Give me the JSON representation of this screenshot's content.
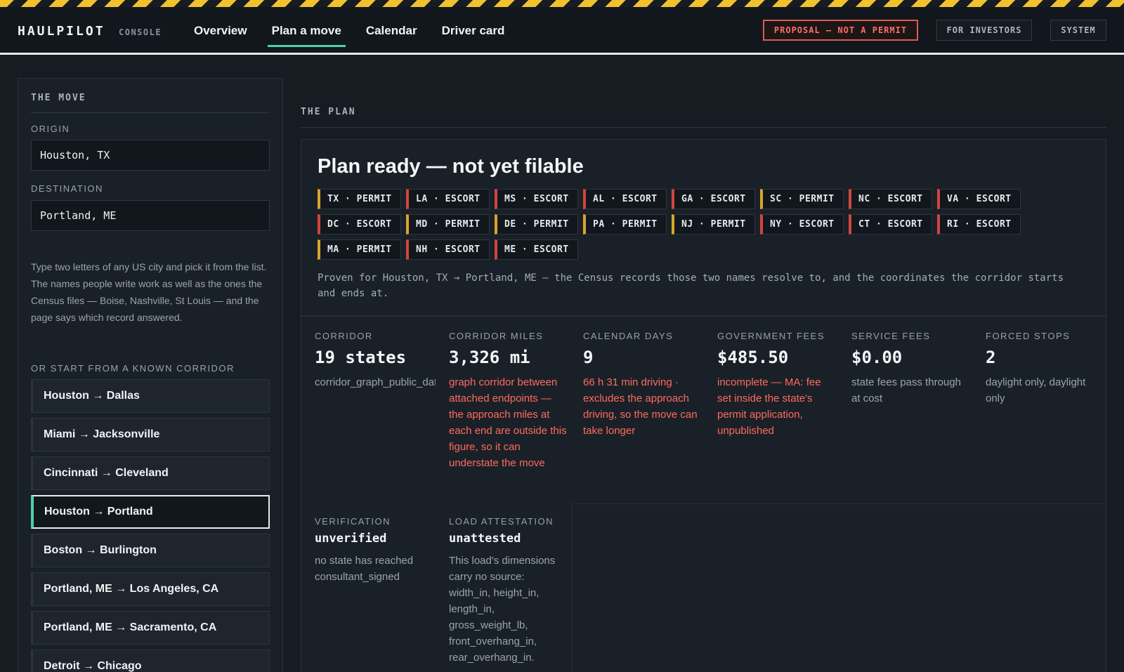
{
  "brand": {
    "name": "HAULPILOT",
    "sub": "CONSOLE"
  },
  "nav": {
    "items": [
      "Overview",
      "Plan a move",
      "Calendar",
      "Driver card"
    ],
    "active": "Plan a move"
  },
  "header_buttons": {
    "proposal": "PROPOSAL — NOT A PERMIT",
    "investors": "FOR INVESTORS",
    "system": "SYSTEM"
  },
  "move": {
    "title": "THE MOVE",
    "origin_label": "ORIGIN",
    "origin_value": "Houston, TX",
    "destination_label": "DESTINATION",
    "destination_value": "Portland, ME",
    "help": "Type two letters of any US city and pick it from the list. The names people write work as well as the ones the Census files — Boise, Nashville, St Louis — and the page says which record answered.",
    "corridor_label": "OR START FROM A KNOWN CORRIDOR",
    "corridors": [
      "Houston → Dallas",
      "Miami → Jacksonville",
      "Cincinnati → Cleveland",
      "Houston → Portland",
      "Boston → Burlington",
      "Portland, ME → Los Angeles, CA",
      "Portland, ME → Sacramento, CA",
      "Detroit → Chicago"
    ],
    "active_corridor": "Houston → Portland"
  },
  "plan": {
    "title": "THE PLAN",
    "headline": "Plan ready — not yet filable",
    "chips": [
      [
        "TX · PERMIT",
        "LA · ESCORT",
        "MS · ESCORT",
        "AL · ESCORT",
        "GA · ESCORT",
        "SC · PERMIT",
        "NC · ESCORT",
        "VA · ESCORT"
      ],
      [
        "DC · ESCORT",
        "MD · PERMIT",
        "DE · PERMIT",
        "PA · PERMIT",
        "NJ · PERMIT",
        "NY · ESCORT",
        "CT · ESCORT",
        "RI · ESCORT"
      ],
      [
        "MA · PERMIT",
        "NH · ESCORT",
        "ME · ESCORT"
      ]
    ],
    "chip_colors": {
      "permit": "#d8a52a",
      "escort": "#d0463f"
    },
    "proven": "Proven for Houston, TX → Portland, ME — the Census records those two names resolve to, and the coordinates the corridor starts and ends at.",
    "stats": {
      "corridor": {
        "label": "CORRIDOR",
        "value": "19 states",
        "note": "corridor_graph_public_data"
      },
      "miles": {
        "label": "CORRIDOR MILES",
        "value": "3,326 mi",
        "note": "graph corridor between attached endpoints — the approach miles at each end are outside this figure, so it can understate the move"
      },
      "days": {
        "label": "CALENDAR DAYS",
        "value": "9",
        "note": "66 h 31 min driving · excludes the approach driving, so the move can take longer"
      },
      "gov": {
        "label": "GOVERNMENT FEES",
        "value": "$485.50",
        "note": "incomplete — MA: fee set inside the state's permit application, unpublished"
      },
      "service": {
        "label": "SERVICE FEES",
        "value": "$0.00",
        "note": "state fees pass through at cost"
      },
      "stops": {
        "label": "FORCED STOPS",
        "value": "2",
        "note": "daylight only, daylight only"
      },
      "verification": {
        "label": "VERIFICATION",
        "value": "unverified",
        "note": "no state has reached consultant_signed"
      },
      "attestation": {
        "label": "LOAD ATTESTATION",
        "value": "unattested",
        "note": "This load's dimensions carry no source: width_in, height_in, length_in, gross_weight_lb, front_overhang_in, rear_overhang_in."
      }
    }
  },
  "colors": {
    "accent": "#4fd1a1",
    "warn": "#ff6b5e",
    "hazard": "#f2c12e"
  }
}
